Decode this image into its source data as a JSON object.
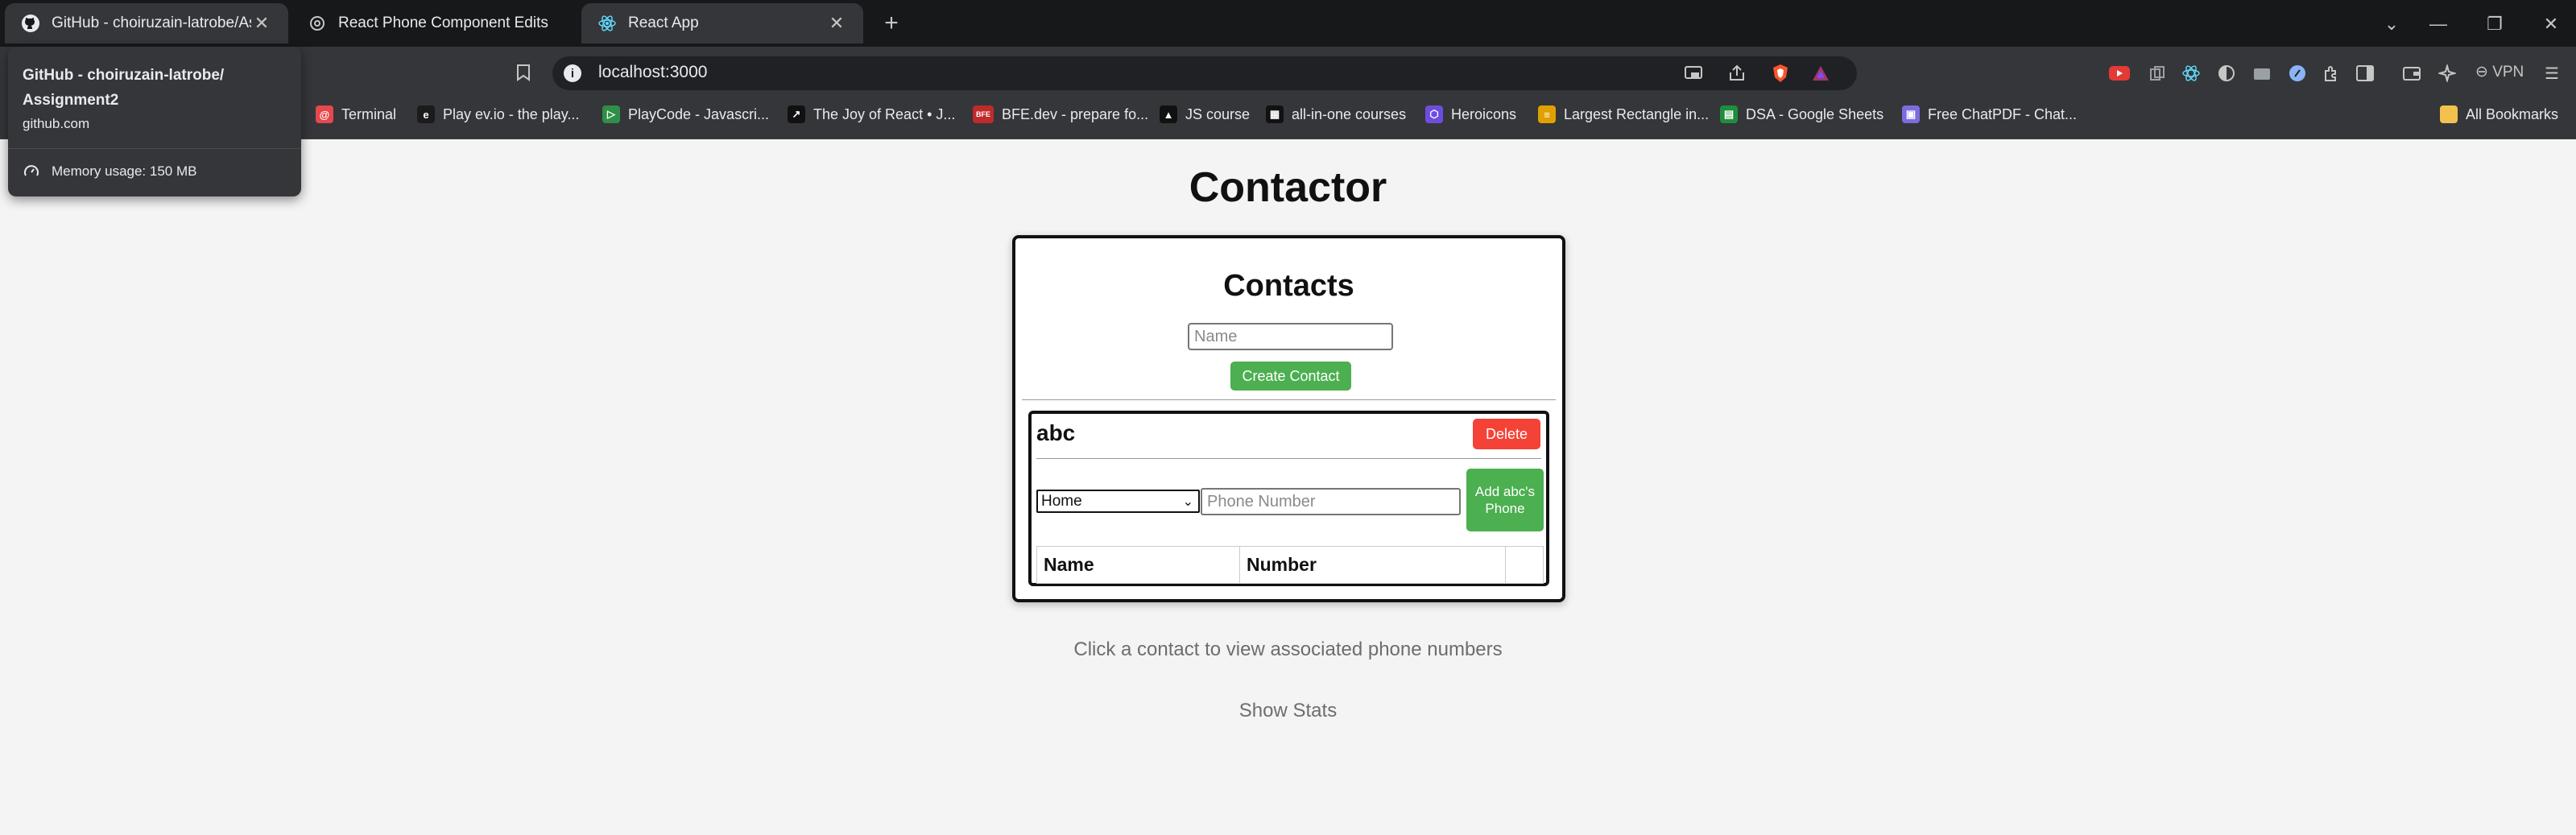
{
  "browser": {
    "tabs": [
      {
        "title": "GitHub - choiruzain-latrobe/Assignment2",
        "icon": "github-icon"
      },
      {
        "title": "React Phone Component Edits",
        "icon": "openai-icon"
      },
      {
        "title": "React App",
        "icon": "react-icon"
      }
    ],
    "new_tab": "+",
    "window_controls": {
      "dropdown": "⌄",
      "minimize": "—",
      "restore": "❐",
      "close": "✕"
    },
    "address": "localhost:3000",
    "vpn_label": "VPN",
    "tooltip": {
      "title": "GitHub - choiruzain-latrobe/ Assignment2",
      "domain": "github.com",
      "memory": "Memory usage: 150 MB"
    },
    "bookmarks": [
      {
        "label": "Terminal",
        "color": "#e5484d",
        "glyph": "@"
      },
      {
        "label": "Play ev.io - the play...",
        "color": "#1b1b1b",
        "glyph": "e"
      },
      {
        "label": "PlayCode - Javascri...",
        "color": "#2f8f46",
        "glyph": "▷"
      },
      {
        "label": "The Joy of React • J...",
        "color": "#111111",
        "glyph": "↗"
      },
      {
        "label": "BFE.dev - prepare fo...",
        "color": "#c02a2a",
        "glyph": "BFE"
      },
      {
        "label": "JS course",
        "color": "#111111",
        "glyph": "▲"
      },
      {
        "label": "all-in-one courses",
        "color": "#111111",
        "glyph": "▦"
      },
      {
        "label": "Heroicons",
        "color": "#6d4de0",
        "glyph": "⬡"
      },
      {
        "label": "Largest Rectangle in...",
        "color": "#e0a100",
        "glyph": "≡"
      },
      {
        "label": "DSA - Google Sheets",
        "color": "#1e8e3e",
        "glyph": "▤"
      },
      {
        "label": "Free ChatPDF - Chat...",
        "color": "#7d6be0",
        "glyph": "▣"
      }
    ],
    "all_bookmarks": "All Bookmarks"
  },
  "app": {
    "title": "Contactor",
    "panel_title": "Contacts",
    "name_placeholder": "Name",
    "create_label": "Create Contact",
    "contact": {
      "name": "abc",
      "delete_label": "Delete",
      "phone_type": "Home",
      "phone_placeholder": "Phone Number",
      "add_phone_label": "Add abc's Phone",
      "table_headers": [
        "Name",
        "Number",
        ""
      ]
    },
    "hint": "Click a contact to view associated phone numbers",
    "stats_label": "Show Stats"
  },
  "colors": {
    "accent_green": "#4caf50",
    "danger_red": "#f44336",
    "chrome_dark": "#202124"
  }
}
